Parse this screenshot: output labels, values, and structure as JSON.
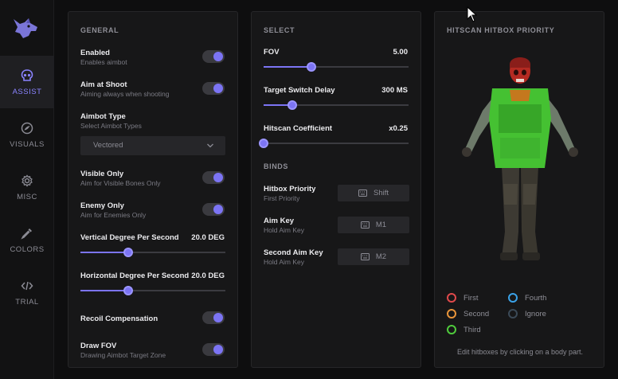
{
  "sidebar": {
    "items": [
      {
        "label": "ASSIST",
        "icon": "skull-icon",
        "active": true
      },
      {
        "label": "VISUALS",
        "icon": "eye-icon",
        "active": false
      },
      {
        "label": "MISC",
        "icon": "gear-icon",
        "active": false
      },
      {
        "label": "COLORS",
        "icon": "eyedropper-icon",
        "active": false
      },
      {
        "label": "TRIAL",
        "icon": "code-icon",
        "active": false
      }
    ]
  },
  "general": {
    "title": "GENERAL",
    "enabled": {
      "label": "Enabled",
      "sub": "Enables aimbot",
      "on": true
    },
    "aim_at_shoot": {
      "label": "Aim at Shoot",
      "sub": "Aiming always when shooting",
      "on": true
    },
    "aimbot_type": {
      "label": "Aimbot Type",
      "sub": "Select Aimbot Types",
      "selected": "Vectored"
    },
    "visible_only": {
      "label": "Visible Only",
      "sub": "Aim for Visible Bones Only",
      "on": true
    },
    "enemy_only": {
      "label": "Enemy Only",
      "sub": "Aim for Enemies Only",
      "on": true
    },
    "vertical": {
      "label": "Vertical Degree Per Second",
      "value": "20.0 DEG",
      "level": 0.33
    },
    "horizontal": {
      "label": "Horizontal Degree Per Second",
      "value": "20.0 DEG",
      "level": 0.33
    },
    "recoil": {
      "label": "Recoil Compensation",
      "on": true
    },
    "draw_fov": {
      "label": "Draw FOV",
      "sub": "Drawing Aimbot Target Zone",
      "on": true
    }
  },
  "select": {
    "title": "SELECT",
    "fov": {
      "label": "FOV",
      "value": "5.00",
      "level": 0.33
    },
    "switch_delay": {
      "label": "Target Switch Delay",
      "value": "300 MS",
      "level": 0.2
    },
    "hitscan_coef": {
      "label": "Hitscan Coefficient",
      "value": "x0.25",
      "level": 0.0
    }
  },
  "binds": {
    "title": "BINDS",
    "hitbox_priority": {
      "label": "Hitbox Priority",
      "sub": "First Priority",
      "key": "Shift"
    },
    "aim_key": {
      "label": "Aim Key",
      "sub": "Hold Aim Key",
      "key": "M1"
    },
    "second_aim_key": {
      "label": "Second Aim Key",
      "sub": "Hold Aim Key",
      "key": "M2"
    }
  },
  "hitbox": {
    "title": "HITSCAN HITBOX PRIORITY",
    "legend": [
      {
        "label": "First",
        "color": "#e0494b"
      },
      {
        "label": "Second",
        "color": "#e8943a"
      },
      {
        "label": "Third",
        "color": "#4fcb3c"
      },
      {
        "label": "Fourth",
        "color": "#3aa2e8"
      },
      {
        "label": "Ignore",
        "color": "#3b4a57"
      }
    ],
    "hint": "Edit hitboxes by clicking on a body part."
  },
  "colors": {
    "accent": "#7c74f4",
    "background": "#0e0e0f",
    "panel": "#171718"
  }
}
